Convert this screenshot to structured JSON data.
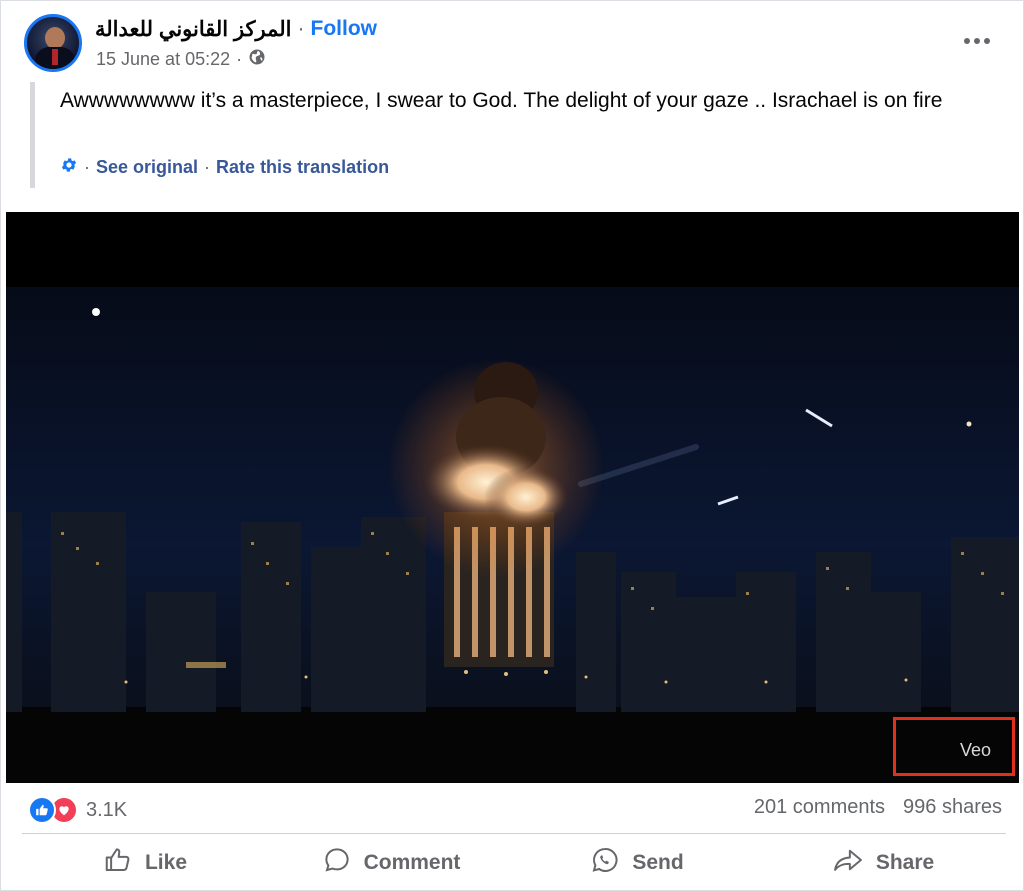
{
  "post": {
    "page_name": "المركز القانوني للعدالة",
    "separator": "·",
    "follow_label": "Follow",
    "timestamp": "15 June at 05:22",
    "audience_separator": "·",
    "audience_icon": "globe-icon",
    "more_icon": "more-options-icon",
    "text": "Awwwwwwww it’s a masterpiece, I swear to God. The delight of your gaze .. Israchael is on fire",
    "translation": {
      "gear_icon": "gear-icon",
      "see_original": "See original",
      "rate_translation": "Rate this translation",
      "separator": "·"
    }
  },
  "video": {
    "watermark": "Veo",
    "highlight_color": "#e0301e"
  },
  "engagement": {
    "reaction_icons": [
      "like-reaction-icon",
      "love-reaction-icon"
    ],
    "reaction_count": "3.1K",
    "comments": "201 comments",
    "shares": "996 shares"
  },
  "actions": [
    {
      "label": "Like",
      "icon": "thumbs-up-icon"
    },
    {
      "label": "Comment",
      "icon": "comment-bubble-icon"
    },
    {
      "label": "Send",
      "icon": "messenger-send-icon"
    },
    {
      "label": "Share",
      "icon": "share-arrow-icon"
    }
  ],
  "colors": {
    "accent": "#1877f2",
    "secondary_text": "#65676b",
    "love": "#f33e58"
  }
}
